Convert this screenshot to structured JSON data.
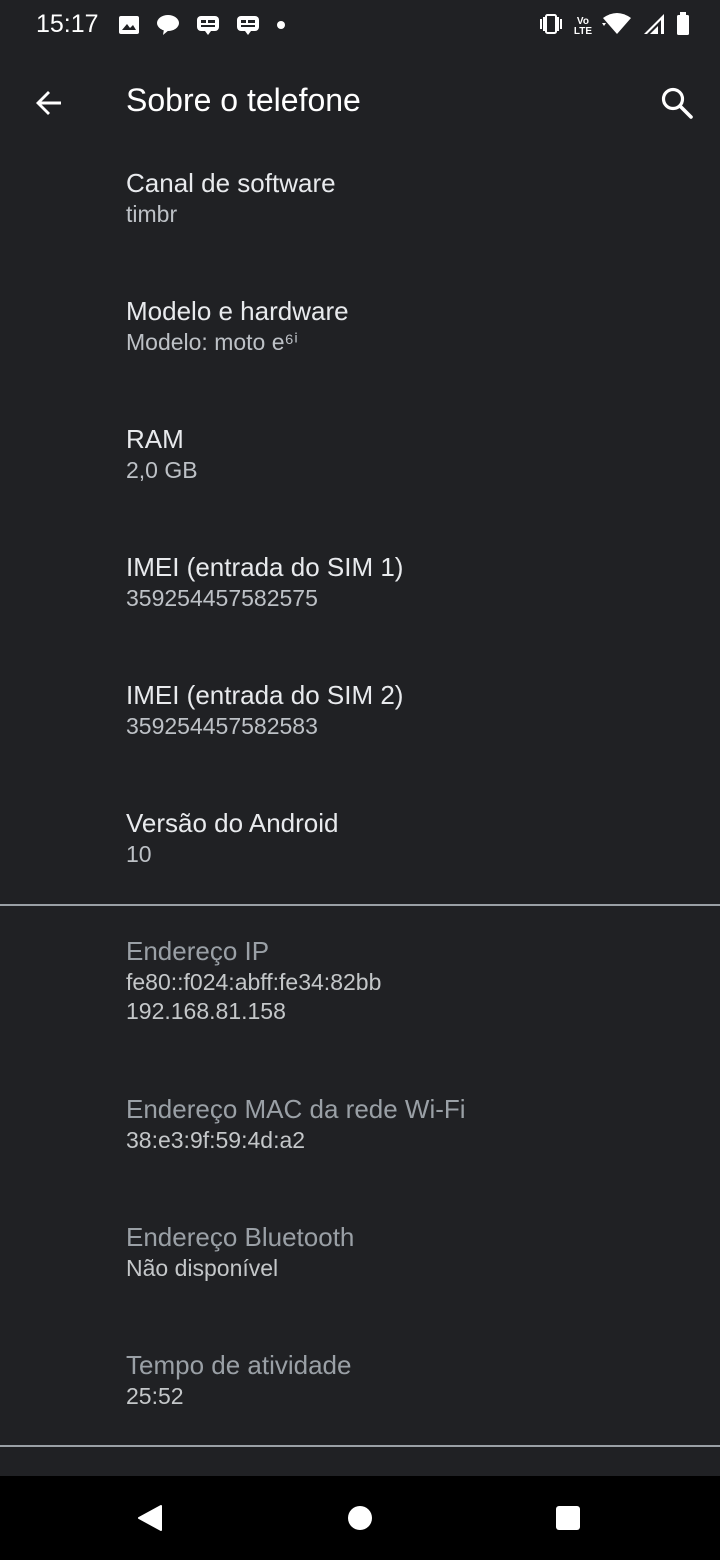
{
  "status_bar": {
    "time": "15:17",
    "left_icons": [
      "image-icon",
      "chat-bubble-icon",
      "message-icon",
      "message-icon",
      "dot-icon"
    ],
    "right_icons": [
      "vibrate-icon",
      "volte-icon",
      "wifi-icon",
      "signal-icon",
      "battery-icon"
    ],
    "volte_top": "Vo",
    "volte_bottom": "LTE"
  },
  "app_bar": {
    "title": "Sobre o telefone",
    "back_icon": "back-arrow-icon",
    "search_icon": "search-icon"
  },
  "items": [
    {
      "title": "Canal de software",
      "value": "timbr"
    },
    {
      "title": "Modelo e hardware",
      "value": "Modelo: moto e⁶ⁱ"
    },
    {
      "title": "RAM",
      "value": "2,0 GB"
    },
    {
      "title": "IMEI (entrada do SIM 1)",
      "value": "359254457582575"
    },
    {
      "title": "IMEI (entrada do SIM 2)",
      "value": "359254457582583"
    },
    {
      "title": "Versão do Android",
      "value": "10"
    }
  ],
  "network_items": [
    {
      "title": "Endereço IP",
      "value": "fe80::f024:abff:fe34:82bb",
      "value2": "192.168.81.158"
    },
    {
      "title": "Endereço MAC da rede Wi-Fi",
      "value": "38:e3:9f:59:4d:a2"
    },
    {
      "title": "Endereço Bluetooth",
      "value": "Não disponível"
    },
    {
      "title": "Tempo de atividade",
      "value": "25:52"
    }
  ],
  "nav_bar": {
    "back": "nav-back-icon",
    "home": "nav-home-icon",
    "recents": "nav-recents-icon"
  },
  "colors": {
    "background": "#202124",
    "text_primary": "#e8eaed",
    "text_secondary": "#bdc1c6",
    "nav_background": "#000000"
  }
}
